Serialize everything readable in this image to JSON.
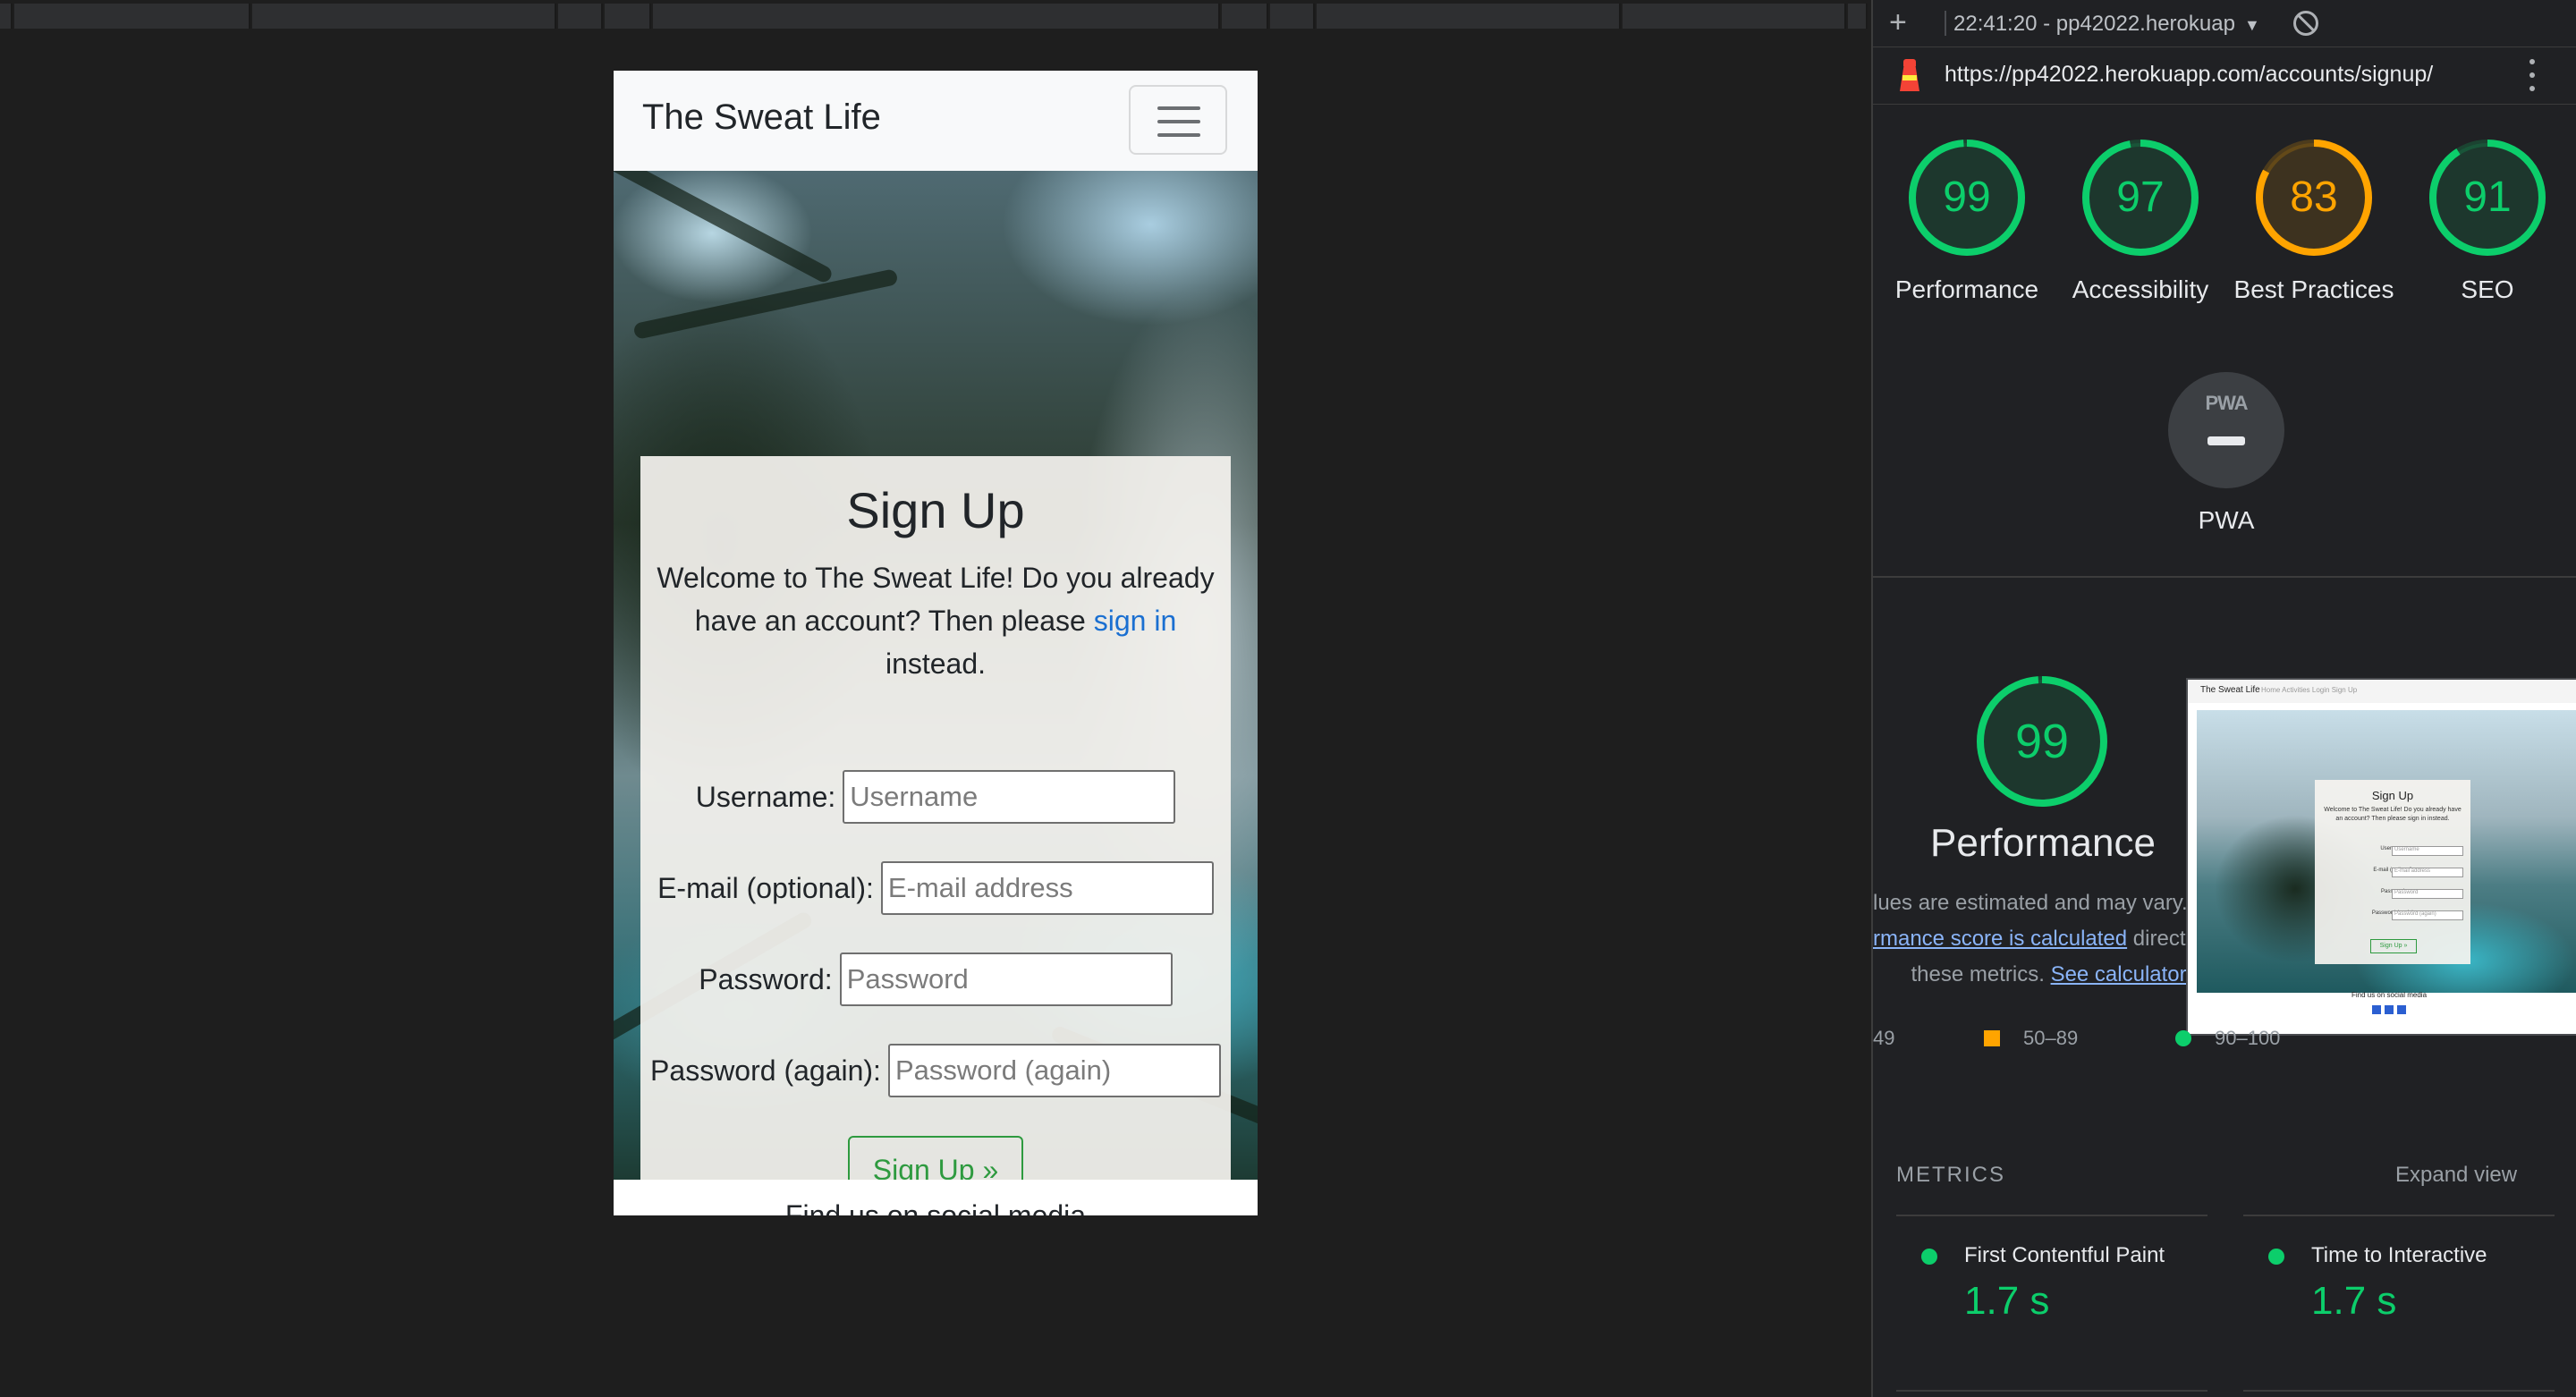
{
  "app_preview": {
    "brand": "The Sweat Life",
    "signup": {
      "title": "Sign Up",
      "intro_before": "Welcome to The Sweat Life! Do you already have an account? Then please",
      "intro_link": "sign in",
      "intro_after": "instead.",
      "fields": [
        {
          "label": "Username:",
          "placeholder": "Username"
        },
        {
          "label": "E-mail (optional):",
          "placeholder": "E-mail address"
        },
        {
          "label": "Password:",
          "placeholder": "Password"
        },
        {
          "label": "Password (again):",
          "placeholder": "Password (again)"
        }
      ],
      "button": "Sign Up »"
    },
    "footer": "Find us on social media"
  },
  "lighthouse": {
    "toolbar": {
      "plus": "+",
      "report_select": "22:41:20 - pp42022.herokuap",
      "caret": "▼"
    },
    "url": "https://pp42022.herokuapp.com/accounts/signup/",
    "scores": [
      {
        "label": "Performance",
        "value": "99",
        "fraction": 0.99,
        "color": "#0cce6b"
      },
      {
        "label": "Accessibility",
        "value": "97",
        "fraction": 0.97,
        "color": "#0cce6b"
      },
      {
        "label": "Best Practices",
        "value": "83",
        "fraction": 0.83,
        "color": "#ffa400"
      },
      {
        "label": "SEO",
        "value": "91",
        "fraction": 0.91,
        "color": "#0cce6b"
      }
    ],
    "pwa": {
      "badge": "PWA",
      "label": "PWA"
    },
    "performance": {
      "score": "99",
      "title": "Performance",
      "desc_line1": "lues are estimated and may vary.",
      "desc_link": "rmance score is calculated",
      "desc_line2_rest": "direct",
      "desc_line3": "these metrics.",
      "desc_link2": "See calculator."
    },
    "screenshot": {
      "brand": "The Sweat Life",
      "nav": "Home   Activities   Login   Sign Up",
      "title": "Sign Up",
      "text": "Welcome to The Sweat Life! Do you already have an account? Then please sign in instead.",
      "rows": [
        "Username:",
        "E-mail (optional):",
        "Password:",
        "Password (again):"
      ],
      "placeholders": [
        "Username",
        "E-mail address",
        "Password",
        "Password (again)"
      ],
      "button": "Sign Up »",
      "footer": "Find us on social media"
    },
    "legend": {
      "low": "49",
      "mid": "50–89",
      "high": "90–100"
    },
    "metrics": {
      "header": "METRICS",
      "expand": "Expand view",
      "items": [
        {
          "name": "First Contentful Paint",
          "value": "1.7 s"
        },
        {
          "name": "Time to Interactive",
          "value": "1.7 s"
        }
      ]
    }
  }
}
